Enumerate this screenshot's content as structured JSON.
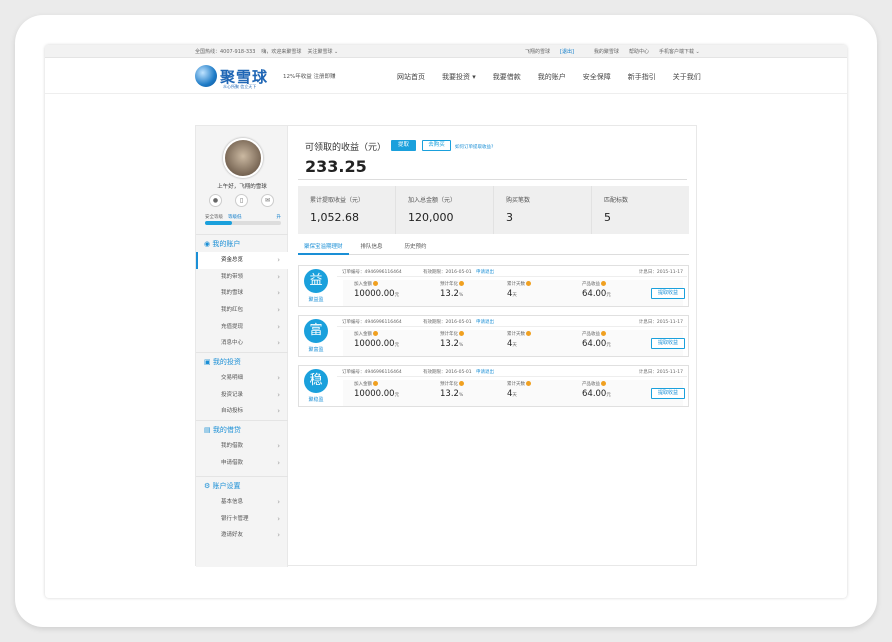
{
  "topbar": {
    "left": [
      "全国热线：4007-918-333",
      "嗨，欢迎来聚雪球",
      "关注聚雪球 ⌄"
    ],
    "right": {
      "welcome": "飞翔的雪球",
      "logout": "[退出]",
      "my": "我的聚雪球",
      "help": "帮助中心",
      "app": "手机客户端下载 ⌄"
    }
  },
  "header": {
    "logo_name": "聚雪球",
    "logo_sub": "众心所聚  信立天下",
    "slogan": "12%年收益  注册即赚",
    "nav": [
      "网站首页",
      "我要投资 ▾",
      "我要借款",
      "我的账户",
      "安全保障",
      "新手指引",
      "关于我们"
    ]
  },
  "side": {
    "greeting": "上午好，飞翔的雪球",
    "security_label": "安全等级",
    "security_level": "等级低",
    "security_action": "升",
    "security_progress": 0.35,
    "groups": [
      {
        "title": "我的账户",
        "icon": "user-icon",
        "items": [
          "资金总览",
          "我的带领",
          "我的雪球",
          "我的红包",
          "充值提现",
          "消息中心"
        ]
      },
      {
        "title": "我的投资",
        "icon": "invest-icon",
        "items": [
          "交易明细",
          "投资记录",
          "自动投标"
        ]
      },
      {
        "title": "我的借贷",
        "icon": "loan-icon",
        "items": [
          "我的借款",
          "申请借款"
        ]
      },
      {
        "title": "账户设置",
        "icon": "settings-icon",
        "items": [
          "基本信息",
          "银行卡管理",
          "邀请好友"
        ]
      }
    ]
  },
  "earnings": {
    "title": "可领取的收益（元）",
    "withdraw": "提取",
    "reinvest": "去购买",
    "link": "如何订单提取收益?",
    "value": "233.25"
  },
  "stats": [
    {
      "label": "累计提取收益（元）",
      "value": "1,052.68"
    },
    {
      "label": "加入总金额（元）",
      "value": "120,000"
    },
    {
      "label": "购买笔数",
      "value": "3"
    },
    {
      "label": "匹配标数",
      "value": "5"
    }
  ],
  "tabs": [
    "聚保宝溢期理财",
    "排队信息",
    "历史预约"
  ],
  "cards": [
    {
      "char": "益",
      "name": "聚益盈",
      "order": "订单编号：4946996116464",
      "date": "有效期限：2016-05-01",
      "redeem": "申请退出",
      "interest": "计息日：2015-11-17",
      "amount_label": "加入金额",
      "amount": "10000.00",
      "amount_unit": "元",
      "rate_label": "预计年化",
      "rate": "13.2",
      "rate_unit": "%",
      "days_label": "累计天数",
      "days": "4",
      "days_unit": "天",
      "earn_label": "产品收益",
      "earn": "64.00",
      "earn_unit": "元",
      "btn": "提取收益"
    },
    {
      "char": "富",
      "name": "聚富盈",
      "order": "订单编号：4946996116464",
      "date": "有效期限：2016-05-01",
      "redeem": "申请退出",
      "interest": "计息日：2015-11-17",
      "amount_label": "加入金额",
      "amount": "10000.00",
      "amount_unit": "元",
      "rate_label": "预计年化",
      "rate": "13.2",
      "rate_unit": "%",
      "days_label": "累计天数",
      "days": "4",
      "days_unit": "天",
      "earn_label": "产品收益",
      "earn": "64.00",
      "earn_unit": "元",
      "btn": "提取收益"
    },
    {
      "char": "稳",
      "name": "聚稳盈",
      "order": "订单编号：4946996116464",
      "date": "有效期限：2016-05-01",
      "redeem": "申请退出",
      "interest": "计息日：2015-11-17",
      "amount_label": "加入金额",
      "amount": "10000.00",
      "amount_unit": "元",
      "rate_label": "预计年化",
      "rate": "13.2",
      "rate_unit": "%",
      "days_label": "累计天数",
      "days": "4",
      "days_unit": "天",
      "earn_label": "产品收益",
      "earn": "64.00",
      "earn_unit": "元",
      "btn": "提取收益"
    }
  ],
  "colors": {
    "accent": "#1aa0dc",
    "brand": "#1f66b5"
  }
}
